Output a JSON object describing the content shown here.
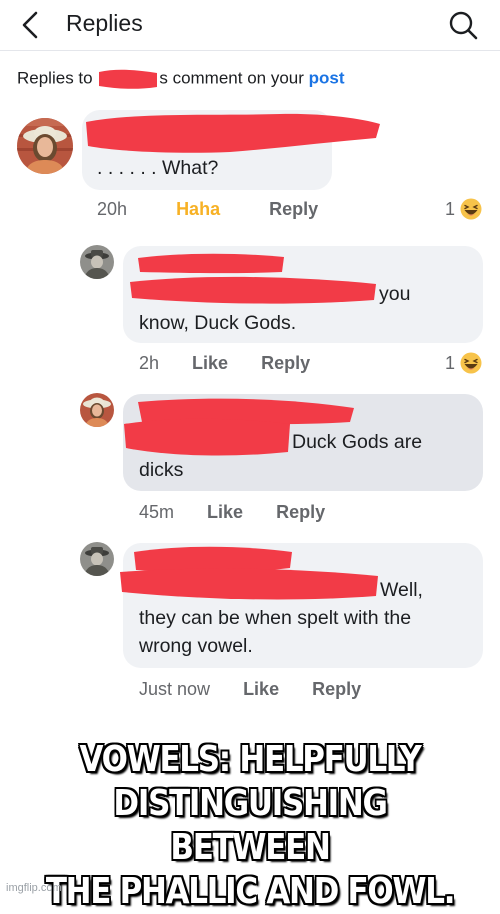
{
  "header": {
    "title": "Replies",
    "back_icon": "chevron-left-icon",
    "search_icon": "search-icon"
  },
  "context": {
    "prefix": "Replies to",
    "suffix": "s comment on your",
    "link": "post"
  },
  "colors": {
    "link": "#1b74e4",
    "haha": "#f7b125",
    "redaction": "#f23b47",
    "bubble": "#f0f2f5",
    "bubble_selected": "#e4e6eb"
  },
  "comments": [
    {
      "text_lines": [
        ". . . . . . What?"
      ],
      "timestamp": "20h",
      "actions": [
        "Haha",
        "Reply"
      ],
      "reaction_count": "1",
      "reaction_icon": "haha-emoji-icon"
    },
    {
      "text_lines": [
        "you",
        "know, Duck Gods."
      ],
      "timestamp": "2h",
      "actions": [
        "Like",
        "Reply"
      ],
      "reaction_count": "1",
      "reaction_icon": "haha-emoji-icon"
    },
    {
      "text_lines": [
        "Duck Gods are",
        "dicks"
      ],
      "timestamp": "45m",
      "actions": [
        "Like",
        "Reply"
      ]
    },
    {
      "text_lines": [
        "Well,",
        "they can be when spelt with the",
        "wrong vowel."
      ],
      "timestamp": "Just now",
      "actions": [
        "Like",
        "Reply"
      ]
    }
  ],
  "caption": {
    "lines": [
      "VOWELS: HELPFULLY",
      "DISTINGUISHING BETWEEN",
      "THE PHALLIC AND FOWL."
    ]
  },
  "watermark": "imgflip.com"
}
